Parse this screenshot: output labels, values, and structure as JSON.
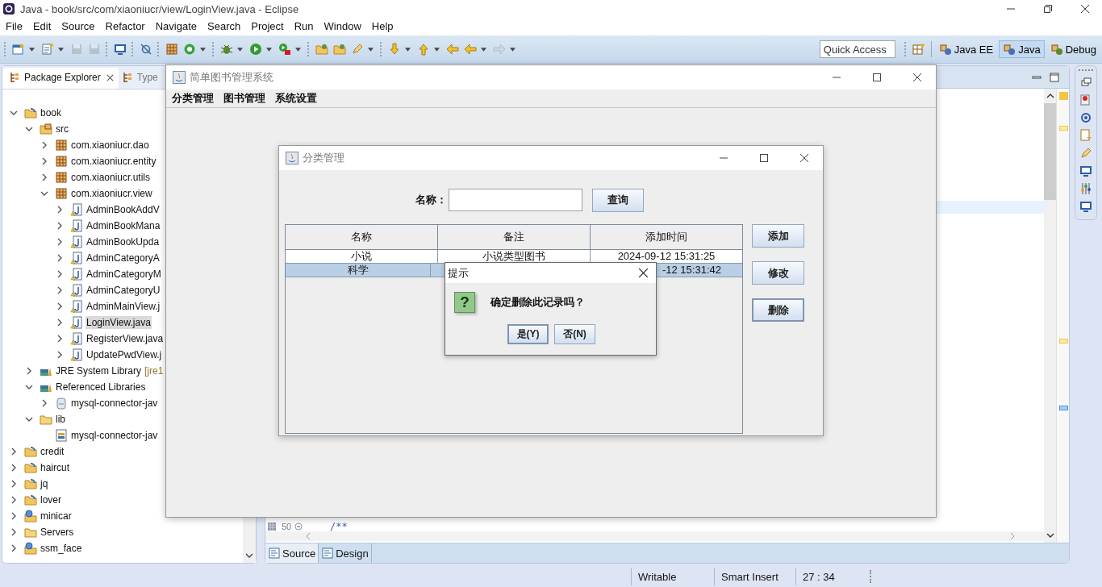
{
  "window": {
    "title": "Java - book/src/com/xiaoniucr/view/LoginView.java - Eclipse"
  },
  "menu": [
    "File",
    "Edit",
    "Source",
    "Refactor",
    "Navigate",
    "Search",
    "Project",
    "Run",
    "Window",
    "Help"
  ],
  "quick_access": {
    "placeholder": "Quick Access"
  },
  "perspectives": [
    {
      "label": "Java EE",
      "selected": false
    },
    {
      "label": "Java",
      "selected": true
    },
    {
      "label": "Debug",
      "selected": false
    }
  ],
  "package_explorer": {
    "tabs": [
      {
        "label": "Package Explorer",
        "selected": true
      },
      {
        "label": "Type",
        "selected": false
      }
    ],
    "tree": [
      {
        "label": "book",
        "kind": "project",
        "expanded": true,
        "selected": false,
        "children": [
          {
            "label": "src",
            "kind": "source-folder",
            "expanded": true,
            "selected": false,
            "children": [
              {
                "label": "com.xiaoniucr.dao",
                "kind": "package",
                "expanded": false,
                "selected": false
              },
              {
                "label": "com.xiaoniucr.entity",
                "kind": "package",
                "expanded": false,
                "selected": false
              },
              {
                "label": "com.xiaoniucr.utils",
                "kind": "package",
                "expanded": false,
                "selected": false
              },
              {
                "label": "com.xiaoniucr.view",
                "kind": "package",
                "expanded": true,
                "selected": false,
                "children": [
                  {
                    "label": "AdminBookAddV",
                    "kind": "java-file",
                    "expanded": false,
                    "selected": false
                  },
                  {
                    "label": "AdminBookMana",
                    "kind": "java-file",
                    "expanded": false,
                    "selected": false
                  },
                  {
                    "label": "AdminBookUpda",
                    "kind": "java-file",
                    "expanded": false,
                    "selected": false
                  },
                  {
                    "label": "AdminCategoryA",
                    "kind": "java-file",
                    "expanded": false,
                    "selected": false
                  },
                  {
                    "label": "AdminCategoryM",
                    "kind": "java-file",
                    "expanded": false,
                    "selected": false
                  },
                  {
                    "label": "AdminCategoryU",
                    "kind": "java-file",
                    "expanded": false,
                    "selected": false
                  },
                  {
                    "label": "AdminMainView.j",
                    "kind": "java-file",
                    "expanded": false,
                    "selected": false
                  },
                  {
                    "label": "LoginView.java",
                    "kind": "java-file",
                    "expanded": false,
                    "selected": true
                  },
                  {
                    "label": "RegisterView.java",
                    "kind": "java-file",
                    "expanded": false,
                    "selected": false
                  },
                  {
                    "label": "UpdatePwdView.j",
                    "kind": "java-file",
                    "expanded": false,
                    "selected": false
                  }
                ]
              }
            ]
          },
          {
            "label": "JRE System Library",
            "decoration": "[jre1",
            "kind": "library",
            "expanded": false,
            "selected": false
          },
          {
            "label": "Referenced Libraries",
            "kind": "library",
            "expanded": true,
            "selected": false,
            "children": [
              {
                "label": "mysql-connector-jav",
                "kind": "jar",
                "expanded": false,
                "selected": false
              }
            ]
          },
          {
            "label": "lib",
            "kind": "folder",
            "expanded": true,
            "selected": false,
            "children": [
              {
                "label": "mysql-connector-jav",
                "kind": "jar-file",
                "selected": false
              }
            ]
          }
        ]
      },
      {
        "label": "credit",
        "kind": "project",
        "expanded": false,
        "selected": false
      },
      {
        "label": "haircut",
        "kind": "project",
        "expanded": false,
        "selected": false
      },
      {
        "label": "jq",
        "kind": "project",
        "expanded": false,
        "selected": false
      },
      {
        "label": "lover",
        "kind": "project",
        "expanded": false,
        "selected": false
      },
      {
        "label": "minicar",
        "kind": "web-project",
        "expanded": false,
        "selected": false
      },
      {
        "label": "Servers",
        "kind": "folder",
        "expanded": false,
        "selected": false
      },
      {
        "label": "ssm_face",
        "kind": "web-project",
        "expanded": false,
        "selected": false
      }
    ]
  },
  "editor": {
    "lines": [
      {
        "number": "50",
        "code": "/**"
      }
    ],
    "tabs": [
      {
        "label": "Source",
        "selected": true
      },
      {
        "label": "Design",
        "selected": false
      }
    ]
  },
  "status_bar": [
    "Writable",
    "Smart Insert",
    "27 : 34"
  ],
  "app_window": {
    "title": "简单图书管理系统",
    "menu": [
      "分类管理",
      "图书管理",
      "系统设置"
    ]
  },
  "category_dialog": {
    "title": "分类管理",
    "search_label": "名称：",
    "search_button": "查询",
    "columns": [
      "名称",
      "备注",
      "添加时间"
    ],
    "rows": [
      {
        "name": "小说",
        "note": "小说类型图书",
        "time": "2024-09-12 15:31:25",
        "selected": false
      },
      {
        "name": "科学",
        "time": "-12 15:31:42",
        "selected": true
      }
    ],
    "buttons": [
      {
        "label": "添加",
        "focused": false
      },
      {
        "label": "修改",
        "focused": false
      },
      {
        "label": "删除",
        "focused": true
      }
    ]
  },
  "confirm_dialog": {
    "title": "提示",
    "icon": "?",
    "message": "确定删除此记录吗？",
    "buttons": [
      {
        "label": "是(Y)",
        "focused": true
      },
      {
        "label": "否(N)",
        "focused": false
      }
    ]
  }
}
